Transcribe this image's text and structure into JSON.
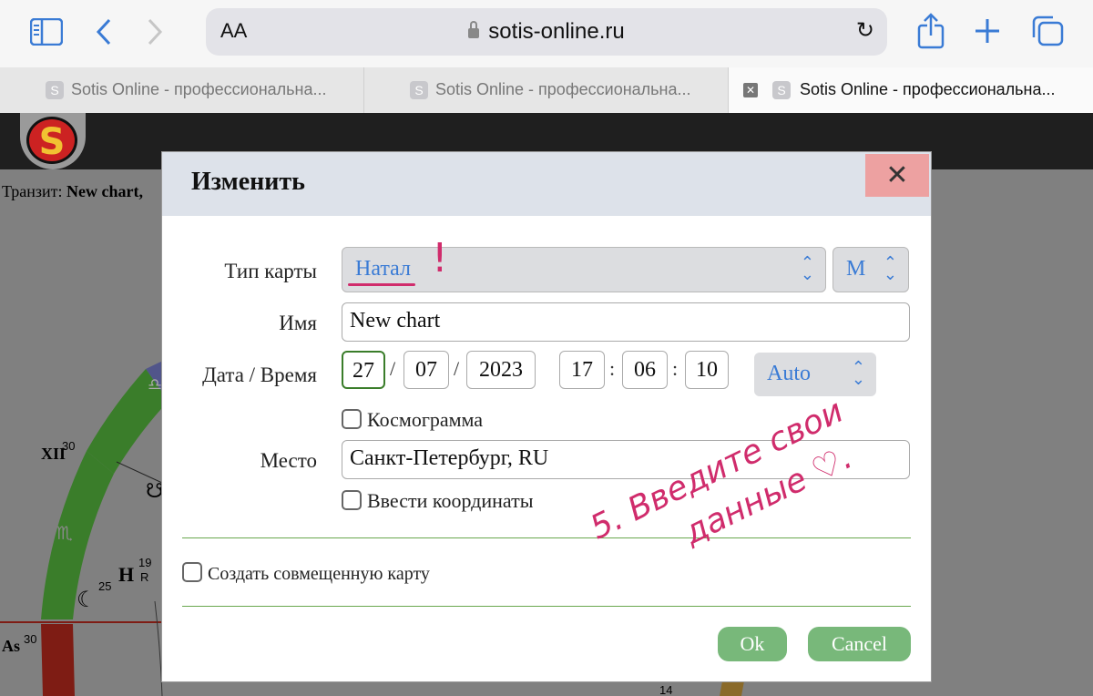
{
  "browser": {
    "url_text": "sotis-online.ru",
    "aa_label": "AA",
    "icons": {
      "sidebar": "sidebar-icon",
      "back": "chevron-left-icon",
      "forward": "chevron-right-icon",
      "lock": "lock-icon",
      "reload": "reload-icon",
      "share": "share-icon",
      "new_tab": "plus-icon",
      "tabs_overview": "tabs-icon"
    },
    "accent_color": "#3a7bd5"
  },
  "tabs": [
    {
      "favicon": "S",
      "title": "Sotis Online - профессиональна..."
    },
    {
      "favicon": "S",
      "title": "Sotis Online - профессиональна..."
    },
    {
      "favicon": "S",
      "title": "Sotis Online - профессиональна...",
      "active": true
    }
  ],
  "page": {
    "transit_prefix": "Транзит: ",
    "transit_name": "New chart,",
    "chart_labels": {
      "house_xii": "XII",
      "house_xii_deg": "30",
      "ascendant": "As",
      "ascendant_deg": "30",
      "moon_deg": "25",
      "planet_deg": "19",
      "retro": "R",
      "bottom_deg": "14"
    }
  },
  "modal": {
    "title": "Изменить",
    "close_glyph": "✕",
    "chart_type_label": "Тип карты",
    "chart_type_value": "Натал",
    "gender_value": "M",
    "name_label": "Имя",
    "name_value": "New chart",
    "datetime_label": "Дата / Время",
    "day": "27",
    "month": "07",
    "year": "2023",
    "hour": "17",
    "minute": "06",
    "second": "10",
    "date_sep": "/",
    "time_sep": ":",
    "timezone_value": "Auto",
    "cosmogram_label": "Космограмма",
    "place_label": "Место",
    "place_value": "Санкт-Петербург, RU",
    "coords_label": "Ввести координаты",
    "composite_label": "Создать совмещенную карту",
    "ok_label": "Ok",
    "cancel_label": "Cancel"
  },
  "annotation": {
    "exclamation": "!",
    "note_line1": "5. Введите свои",
    "note_line2": "данные ♡."
  }
}
